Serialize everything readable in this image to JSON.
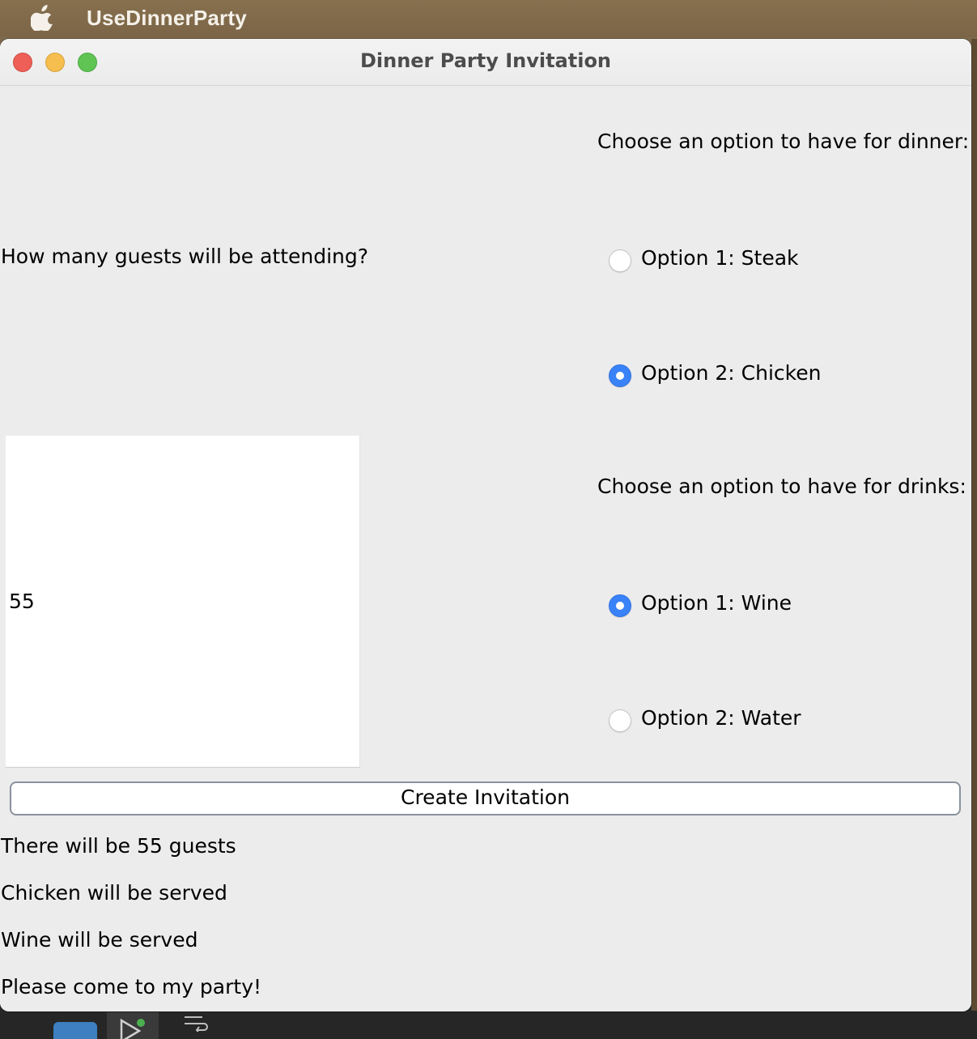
{
  "menubar": {
    "app_name": "UseDinnerParty"
  },
  "window": {
    "title": "Dinner Party Invitation"
  },
  "form": {
    "guests_question": "How many guests will be attending?",
    "guests_value": "55",
    "dinner_heading": "Choose an option to have for dinner:",
    "dinner_options": [
      {
        "label": "Option 1: Steak",
        "selected": false
      },
      {
        "label": "Option 2: Chicken",
        "selected": true
      }
    ],
    "drinks_heading": "Choose an option to have for drinks:",
    "drink_options": [
      {
        "label": "Option 1: Wine",
        "selected": true
      },
      {
        "label": "Option 2: Water",
        "selected": false
      }
    ],
    "create_button_label": "Create Invitation"
  },
  "output": {
    "lines": [
      "There will be 55 guests",
      "Chicken will be served",
      "Wine will be served",
      "Please come to my party!"
    ]
  },
  "colors": {
    "radio_selected": "#3a82f7",
    "window_bg": "#ececec",
    "desktop": "#7d6a4e"
  }
}
